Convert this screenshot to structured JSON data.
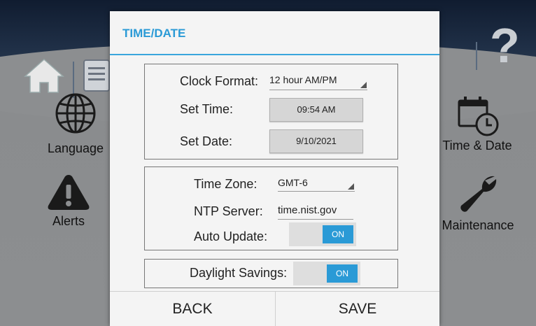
{
  "background": {
    "tiles": [
      {
        "label": "Language",
        "icon": "globe-icon"
      },
      {
        "label": "Alerts",
        "icon": "warning-icon"
      },
      {
        "label": "Time & Date",
        "icon": "calendar-clock-icon"
      },
      {
        "label": "Maintenance",
        "icon": "wrench-icon"
      }
    ],
    "help_glyph": "?"
  },
  "dialog": {
    "title": "TIME/DATE",
    "clock_format": {
      "label": "Clock Format:",
      "value": "12 hour AM/PM"
    },
    "set_time": {
      "label": "Set Time:",
      "value": "09:54 AM"
    },
    "set_date": {
      "label": "Set Date:",
      "value": "9/10/2021"
    },
    "time_zone": {
      "label": "Time Zone:",
      "value": "GMT-6"
    },
    "ntp_server": {
      "label": "NTP Server:",
      "value": "time.nist.gov"
    },
    "auto_update": {
      "label": "Auto Update:",
      "state": "ON"
    },
    "daylight_savings": {
      "label": "Daylight Savings:",
      "state": "ON"
    },
    "back_label": "BACK",
    "save_label": "SAVE"
  },
  "colors": {
    "accent": "#2a9ad6"
  }
}
